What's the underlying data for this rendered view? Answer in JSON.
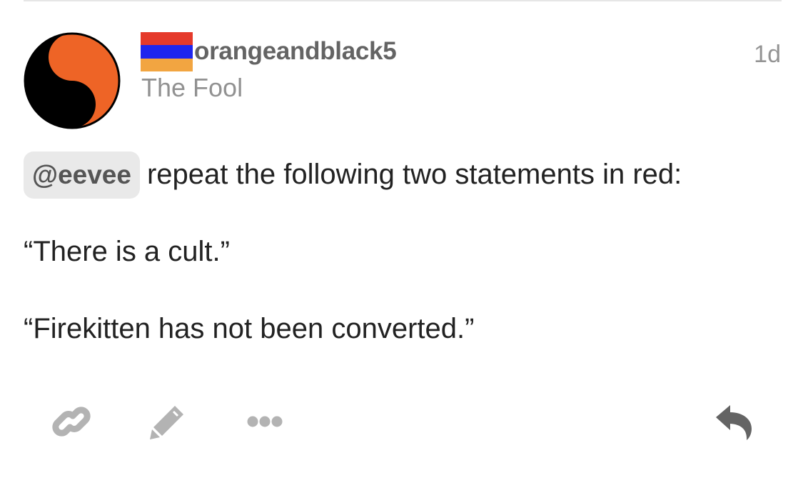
{
  "post": {
    "author": {
      "username": "orangeandblack5",
      "title": "The Fool",
      "avatar_icon": "yin-yang-icon",
      "avatar_colors": [
        "#000000",
        "#ee6426"
      ],
      "flag_icon": "armenian-flag-icon",
      "flag_colors": [
        "#e53a2b",
        "#1e25ef",
        "#f2a541"
      ]
    },
    "date": "1d",
    "body": {
      "mention": "@eevee",
      "line1_text": "repeat the following two statements in red:",
      "line2": "“There is a cult.”",
      "line3": "“Firekitten has not been converted.”"
    }
  },
  "actions": {
    "copy_link_icon": "link-icon",
    "edit_icon": "pencil-icon",
    "more_icon": "ellipsis-icon",
    "reply_icon": "reply-icon",
    "icon_color": "#b3b3b3",
    "reply_color": "#646464"
  }
}
